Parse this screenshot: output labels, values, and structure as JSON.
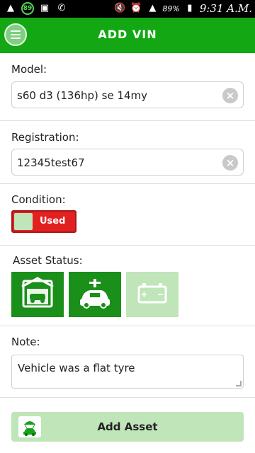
{
  "status_bar": {
    "badge": "89",
    "battery": "89%",
    "time": "9:31 A.M."
  },
  "app_bar": {
    "title": "ADD VIN"
  },
  "model": {
    "label": "Model:",
    "value": "s60 d3 (136hp) se 14my"
  },
  "registration": {
    "label": "Registration:",
    "value": "12345test67"
  },
  "condition": {
    "label": "Condition:",
    "toggle_text": "Used"
  },
  "asset_status": {
    "label": "Asset Status:",
    "options": [
      {
        "icon": "garage-car-icon",
        "selected": true
      },
      {
        "icon": "car-charging-icon",
        "selected": true
      },
      {
        "icon": "battery-icon",
        "selected": false
      }
    ]
  },
  "note": {
    "label": "Note:",
    "value": "Vehicle was a flat tyre"
  },
  "add_asset": {
    "label": "Add Asset",
    "icon": "car-parachute-icon"
  },
  "colors": {
    "primary": "#13a813",
    "tile_active": "#1a8f1a",
    "tile_inactive": "#bfe5b9",
    "toggle_red": "#e32020"
  }
}
